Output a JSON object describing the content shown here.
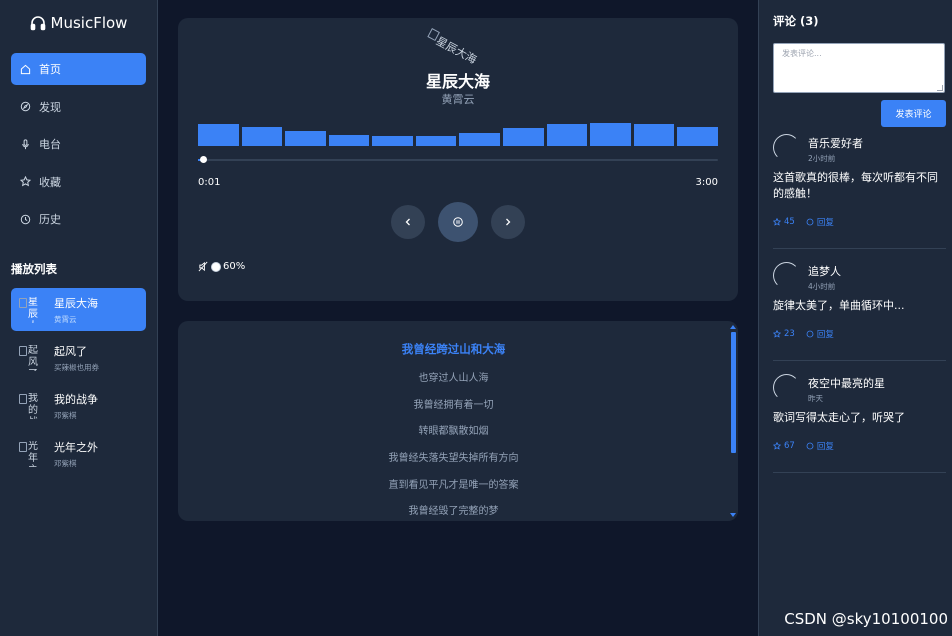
{
  "app": {
    "brand": "MusicFlow"
  },
  "nav": [
    {
      "label": "首页",
      "icon": "home-icon",
      "active": true
    },
    {
      "label": "发现",
      "icon": "compass-icon",
      "active": false
    },
    {
      "label": "电台",
      "icon": "mic-icon",
      "active": false
    },
    {
      "label": "收藏",
      "icon": "star-icon",
      "active": false
    },
    {
      "label": "历史",
      "icon": "clock-icon",
      "active": false
    }
  ],
  "playlist": {
    "title": "播放列表",
    "items": [
      {
        "title": "星辰大海",
        "artist": "黄霄云",
        "cover_alt": "星辰大",
        "active": true
      },
      {
        "title": "起风了",
        "artist": "买辣椒也用券",
        "cover_alt": "起风了",
        "active": false
      },
      {
        "title": "我的战争",
        "artist": "邓紫棋",
        "cover_alt": "我的战",
        "active": false
      },
      {
        "title": "光年之外",
        "artist": "邓紫棋",
        "cover_alt": "光年之",
        "active": false
      }
    ]
  },
  "player": {
    "cover_alt": "星辰大海",
    "title": "星辰大海",
    "artist": "黄霄云",
    "visualizer_levels": [
      0.92,
      0.8,
      0.62,
      0.45,
      0.4,
      0.4,
      0.55,
      0.75,
      0.92,
      0.96,
      0.92,
      0.8
    ],
    "progress_fraction": 0.006,
    "current_time": "0:01",
    "total_time": "3:00",
    "volume_label": "60%",
    "colors": {
      "accent": "#3b82f6",
      "card": "#1e293b",
      "background": "#0f172a"
    }
  },
  "lyrics": {
    "lines": [
      "我曾经跨过山和大海",
      "也穿过人山人海",
      "我曾经拥有着一切",
      "转眼都飘散如烟",
      "我曾经失落失望失掉所有方向",
      "直到看见平凡才是唯一的答案",
      "我曾经毁了完整的梦"
    ],
    "current_index": 0
  },
  "comments": {
    "title": "评论 (3)",
    "placeholder": "发表评论...",
    "submit_label": "发表评论",
    "items": [
      {
        "name": "音乐爱好者",
        "time": "2小时前",
        "text": "这首歌真的很棒，每次听都有不同的感触！",
        "likes": "45",
        "reply": "回复"
      },
      {
        "name": "追梦人",
        "time": "4小时前",
        "text": "旋律太美了，单曲循环中...",
        "likes": "23",
        "reply": "回复"
      },
      {
        "name": "夜空中最亮的星",
        "time": "昨天",
        "text": "歌词写得太走心了，听哭了",
        "likes": "67",
        "reply": "回复"
      }
    ]
  },
  "watermark": "CSDN @sky10100100"
}
